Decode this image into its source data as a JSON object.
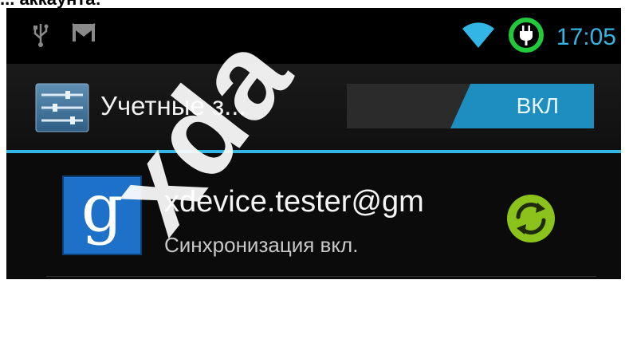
{
  "page_caption": "... аккаунта:",
  "status_bar": {
    "time": "17:05",
    "icons": [
      "usb-icon",
      "gmail-icon",
      "wifi-icon",
      "battery-charging-icon"
    ],
    "accent_color": "#33b5e5",
    "battery_ring_color": "#22c93b"
  },
  "action_bar": {
    "title": "Учетные з...",
    "icon": "settings-icon",
    "toggle": {
      "label": "ВКЛ",
      "state": "on",
      "color": "#1e8ec0"
    }
  },
  "accounts": [
    {
      "icon": "google-icon",
      "icon_letter": "g",
      "email": "xdevice.tester@gm",
      "status": "Синхронизация вкл.",
      "sync_icon": "sync-icon",
      "sync_color": "#8bc21c"
    }
  ],
  "watermark": "xda"
}
